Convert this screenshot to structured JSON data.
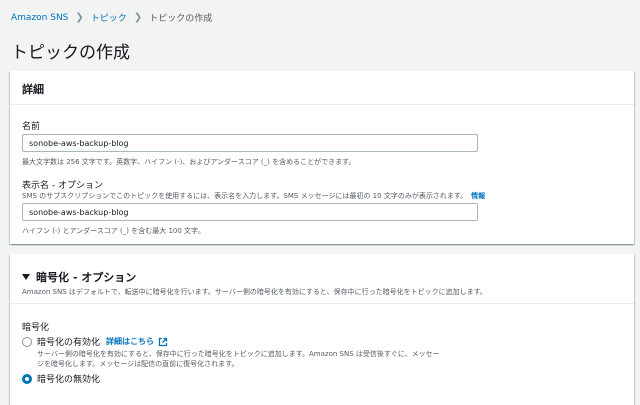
{
  "breadcrumb": {
    "items": [
      "Amazon SNS",
      "トピック"
    ],
    "current": "トピックの作成"
  },
  "page": {
    "title": "トピックの作成"
  },
  "details": {
    "header": "詳細",
    "name": {
      "label": "名前",
      "value": "sonobe-aws-backup-blog",
      "help": "最大文字数は 256 文字です。英数字、ハイフン (-)、およびアンダースコア (_) を含めることができます。"
    },
    "display_name": {
      "label": "表示名 - オプション",
      "description": "SMS のサブスクリプションでこのトピックを使用するには、表示名を入力します。SMS メッセージには最初の 10 文字のみが表示されます。",
      "info_link": "情報",
      "value": "sonobe-aws-backup-blog",
      "help": "ハイフン (-) とアンダースコア (_) を含む最大 100 文字。"
    }
  },
  "encryption": {
    "header": "暗号化 - オプション",
    "description": "Amazon SNS はデフォルトで、転送中に暗号化を行います。サーバー側の暗号化を有効にすると、保存中に行った暗号化をトピックに追加します。",
    "group_label": "暗号化",
    "enable": {
      "label": "暗号化の有効化",
      "link": "詳細はこちら",
      "desc_line1": "サーバー側の暗号化を有効にすると、保存中に行った暗号化をトピックに追加します。Amazon SNS は受信後すぐに、メッセー",
      "desc_line2": "ジを暗号化します。メッセージは配信の直前に復号化されます。",
      "checked": false
    },
    "disable": {
      "label": "暗号化の無効化",
      "checked": true
    }
  },
  "colors": {
    "link": "#0073bb",
    "background": "#f2f3f3"
  }
}
